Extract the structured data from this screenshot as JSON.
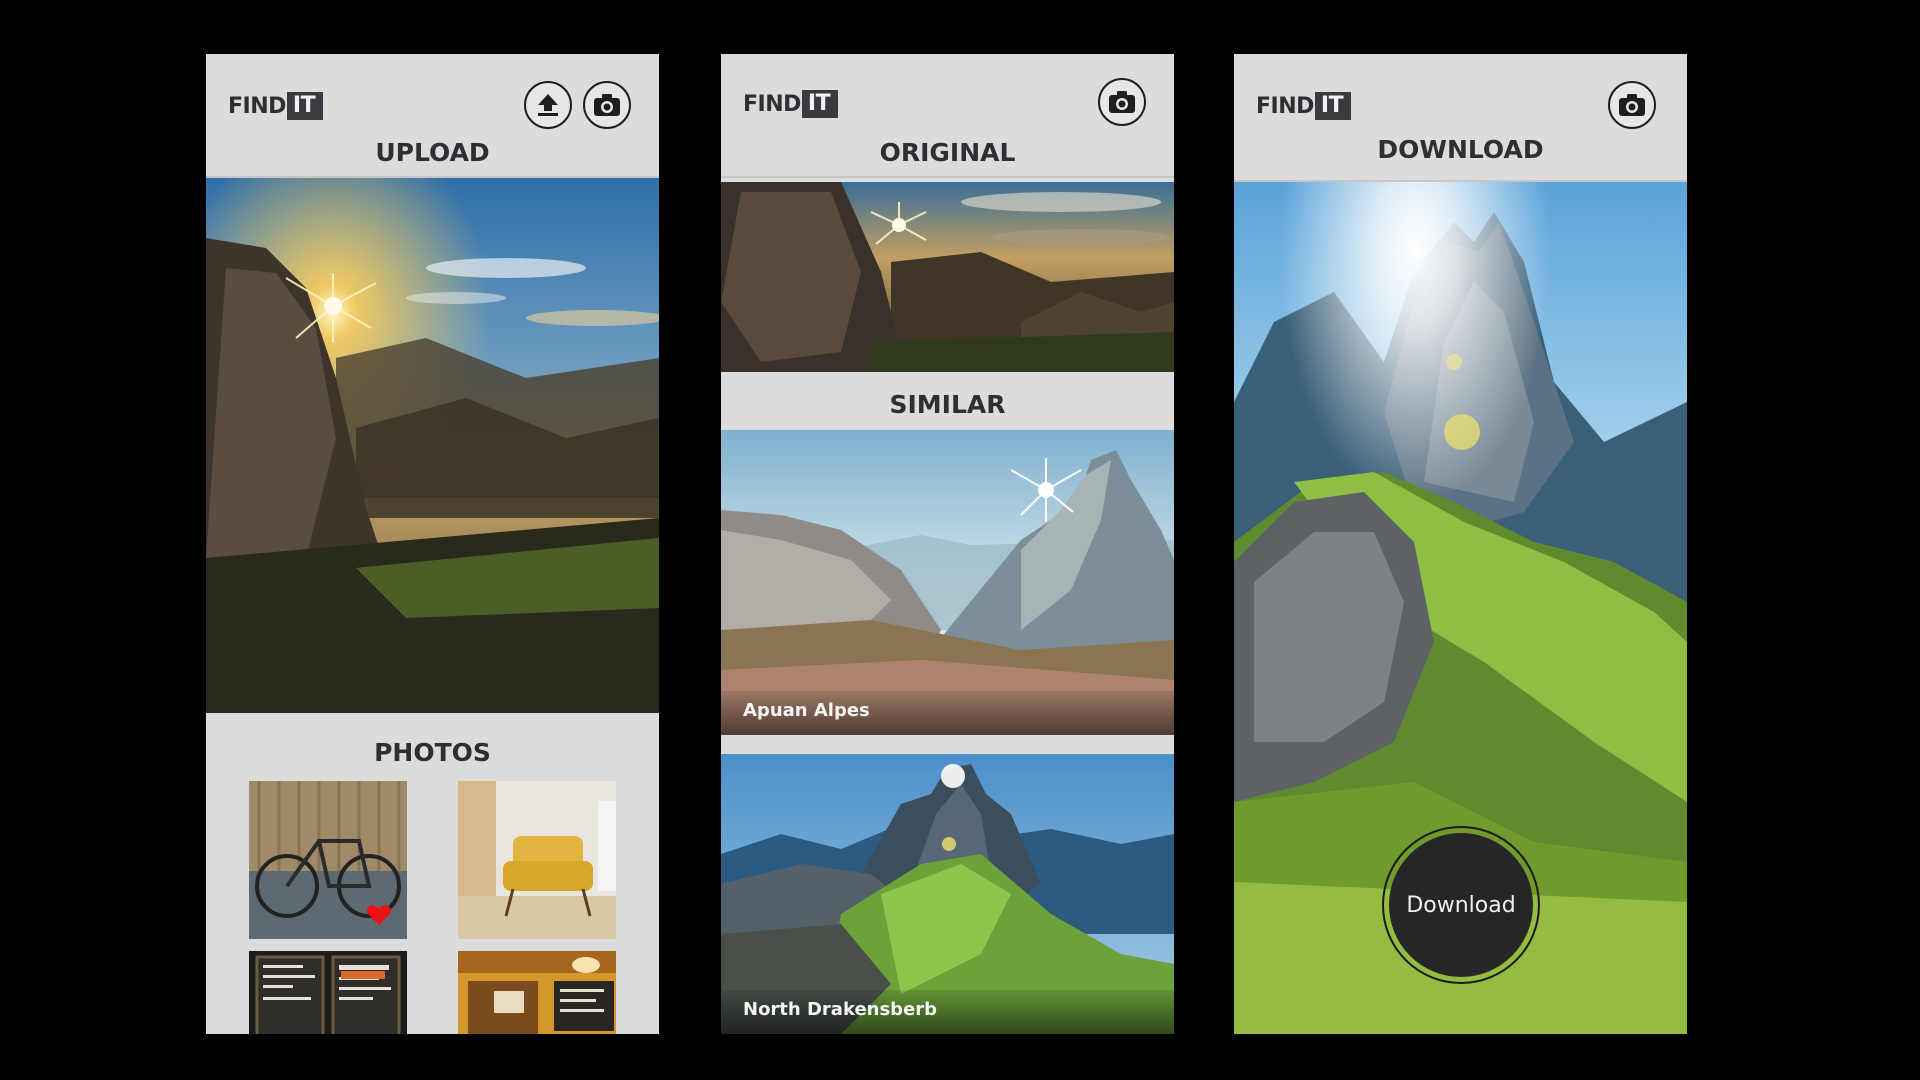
{
  "brand": {
    "logo_main": "FIND",
    "logo_box": "IT"
  },
  "screens": [
    {
      "title": "UPLOAD",
      "icons": [
        "upload-icon",
        "camera-icon"
      ],
      "section_title": "PHOTOS",
      "thumbnails": [
        "bicycle-photo",
        "armchair-photo",
        "bakery-chalkboard-photo",
        "cafe-interior-photo"
      ]
    },
    {
      "title": "ORIGINAL",
      "icons": [
        "camera-icon"
      ],
      "section_title": "SIMILAR",
      "results": [
        {
          "caption": "Apuan Alpes"
        },
        {
          "caption": "North Drakensberb"
        }
      ]
    },
    {
      "title": "DOWNLOAD",
      "icons": [
        "camera-icon"
      ],
      "download_label": "Download"
    }
  ],
  "colors": {
    "background": "#000000",
    "header": "#dcdcdc",
    "title_text": "#2e2e33",
    "logo_box": "#3a3a40",
    "download_button": "#262626"
  }
}
